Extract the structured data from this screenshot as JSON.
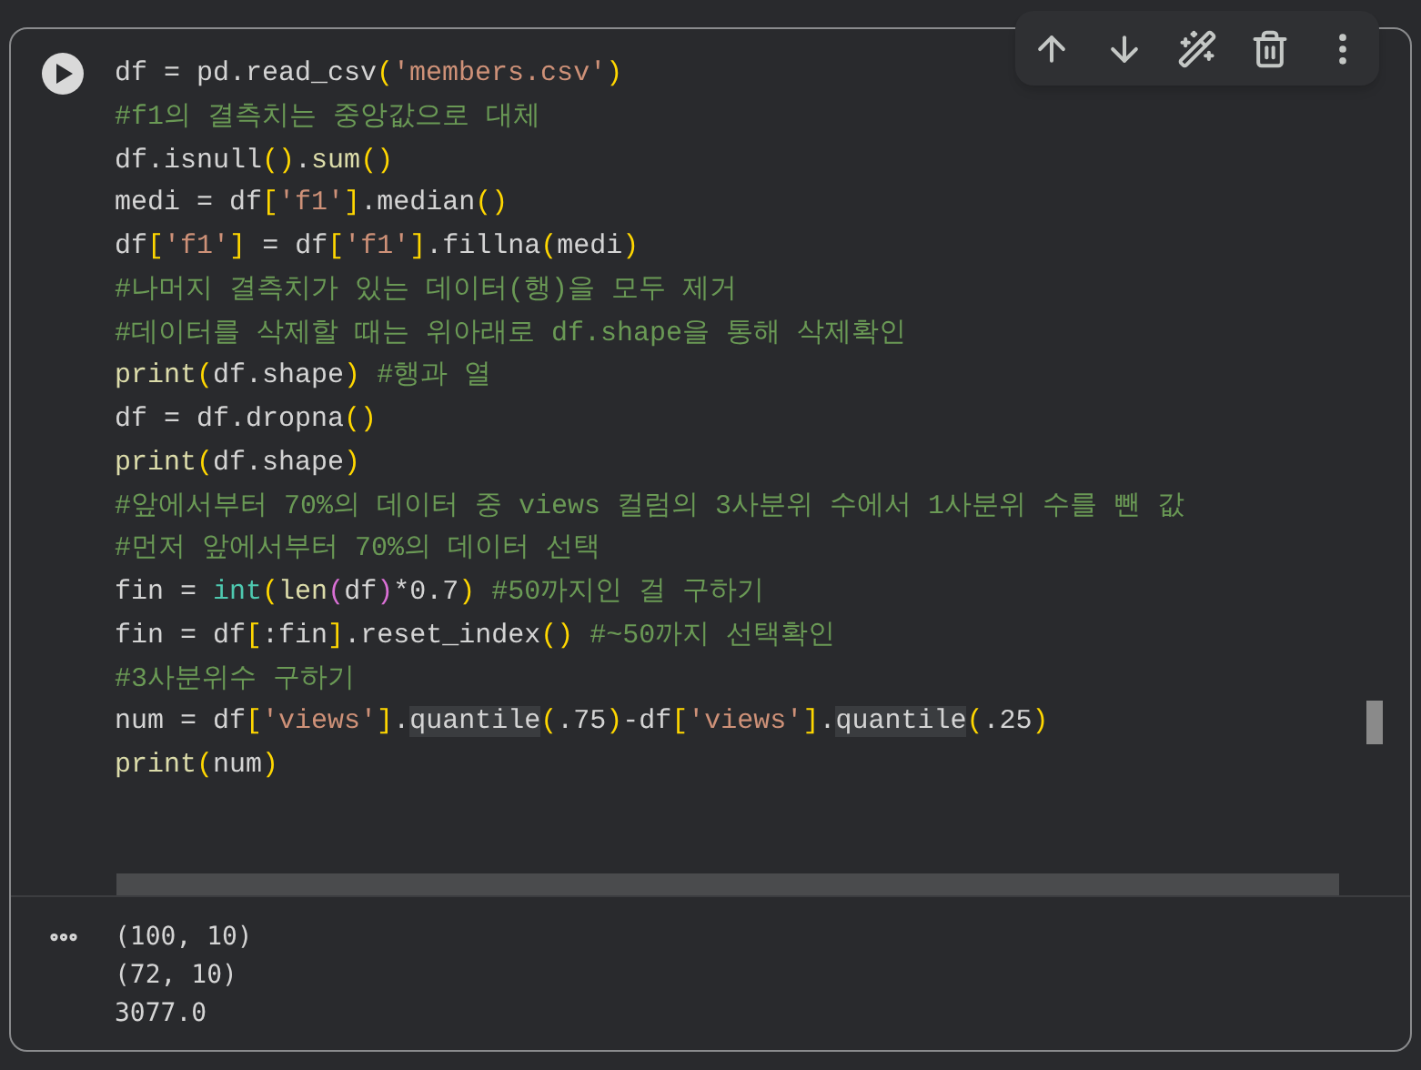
{
  "code_lines": [
    [
      {
        "text": "df = pd.read_csv",
        "kind": "plain"
      },
      {
        "text": "(",
        "kind": "bracket"
      },
      {
        "text": "'members.csv'",
        "kind": "string"
      },
      {
        "text": ")",
        "kind": "bracket"
      }
    ],
    [
      {
        "text": "#f1의 결측치는 중앙값으로 대체",
        "kind": "comment"
      }
    ],
    [
      {
        "text": "df.isnull",
        "kind": "plain"
      },
      {
        "text": "()",
        "kind": "bracket"
      },
      {
        "text": ".",
        "kind": "plain"
      },
      {
        "text": "sum",
        "kind": "func"
      },
      {
        "text": "()",
        "kind": "bracket"
      }
    ],
    [
      {
        "text": "medi = df",
        "kind": "plain"
      },
      {
        "text": "[",
        "kind": "bracket"
      },
      {
        "text": "'f1'",
        "kind": "string"
      },
      {
        "text": "]",
        "kind": "bracket"
      },
      {
        "text": ".median",
        "kind": "plain"
      },
      {
        "text": "()",
        "kind": "bracket"
      }
    ],
    [
      {
        "text": "df",
        "kind": "plain"
      },
      {
        "text": "[",
        "kind": "bracket"
      },
      {
        "text": "'f1'",
        "kind": "string"
      },
      {
        "text": "]",
        "kind": "bracket"
      },
      {
        "text": " = df",
        "kind": "plain"
      },
      {
        "text": "[",
        "kind": "bracket"
      },
      {
        "text": "'f1'",
        "kind": "string"
      },
      {
        "text": "]",
        "kind": "bracket"
      },
      {
        "text": ".fillna",
        "kind": "plain"
      },
      {
        "text": "(",
        "kind": "bracket"
      },
      {
        "text": "medi",
        "kind": "plain"
      },
      {
        "text": ")",
        "kind": "bracket"
      }
    ],
    [
      {
        "text": "#나머지 결측치가 있는 데이터(행)을 모두 제거",
        "kind": "comment"
      }
    ],
    [
      {
        "text": "#데이터를 삭제할 때는 위아래로 df.shape을 통해 삭제확인",
        "kind": "comment"
      }
    ],
    [
      {
        "text": "print",
        "kind": "func"
      },
      {
        "text": "(",
        "kind": "bracket"
      },
      {
        "text": "df.shape",
        "kind": "plain"
      },
      {
        "text": ")",
        "kind": "bracket"
      },
      {
        "text": " #행과 열",
        "kind": "comment"
      }
    ],
    [
      {
        "text": "df = df.dropna",
        "kind": "plain"
      },
      {
        "text": "()",
        "kind": "bracket"
      }
    ],
    [
      {
        "text": "print",
        "kind": "func"
      },
      {
        "text": "(",
        "kind": "bracket"
      },
      {
        "text": "df.shape",
        "kind": "plain"
      },
      {
        "text": ")",
        "kind": "bracket"
      }
    ],
    [
      {
        "text": "#앞에서부터 70%의 데이터 중 views 컬럼의 3사분위 수에서 1사분위 수를 뺀 값",
        "kind": "comment"
      }
    ],
    [
      {
        "text": "#먼저 앞에서부터 70%의 데이터 선택",
        "kind": "comment"
      }
    ],
    [
      {
        "text": "fin = ",
        "kind": "plain"
      },
      {
        "text": "int",
        "kind": "builtin"
      },
      {
        "text": "(",
        "kind": "bracket"
      },
      {
        "text": "len",
        "kind": "func"
      },
      {
        "text": "(",
        "kind": "inner_bracket"
      },
      {
        "text": "df",
        "kind": "plain"
      },
      {
        "text": ")",
        "kind": "inner_bracket"
      },
      {
        "text": "*0.7",
        "kind": "plain"
      },
      {
        "text": ")",
        "kind": "bracket"
      },
      {
        "text": " #50까지인 걸 구하기",
        "kind": "comment"
      }
    ],
    [
      {
        "text": "fin = df",
        "kind": "plain"
      },
      {
        "text": "[",
        "kind": "bracket"
      },
      {
        "text": ":fin",
        "kind": "plain"
      },
      {
        "text": "]",
        "kind": "bracket"
      },
      {
        "text": ".reset_index",
        "kind": "plain"
      },
      {
        "text": "()",
        "kind": "bracket"
      },
      {
        "text": " #~50까지 선택확인",
        "kind": "comment"
      }
    ],
    [
      {
        "text": "#3사분위수 구하기",
        "kind": "comment"
      }
    ],
    [
      {
        "text": "num = df",
        "kind": "plain"
      },
      {
        "text": "[",
        "kind": "bracket"
      },
      {
        "text": "'views'",
        "kind": "string"
      },
      {
        "text": "]",
        "kind": "bracket"
      },
      {
        "text": ".",
        "kind": "plain"
      },
      {
        "text": "quantile",
        "kind": "match"
      },
      {
        "text": "(",
        "kind": "bracket"
      },
      {
        "text": ".75",
        "kind": "plain"
      },
      {
        "text": ")",
        "kind": "bracket"
      },
      {
        "text": "-df",
        "kind": "plain"
      },
      {
        "text": "[",
        "kind": "bracket"
      },
      {
        "text": "'views'",
        "kind": "string"
      },
      {
        "text": "]",
        "kind": "bracket"
      },
      {
        "text": ".",
        "kind": "plain"
      },
      {
        "text": "quantile",
        "kind": "match"
      },
      {
        "text": "(",
        "kind": "bracket"
      },
      {
        "text": ".25",
        "kind": "plain"
      },
      {
        "text": ")",
        "kind": "bracket"
      }
    ],
    [
      {
        "text": "print",
        "kind": "func"
      },
      {
        "text": "(",
        "kind": "bracket"
      },
      {
        "text": "num",
        "kind": "plain"
      },
      {
        "text": ")",
        "kind": "bracket"
      }
    ]
  ],
  "output_lines": [
    "(100, 10)",
    "(72, 10)",
    "3077.0"
  ]
}
